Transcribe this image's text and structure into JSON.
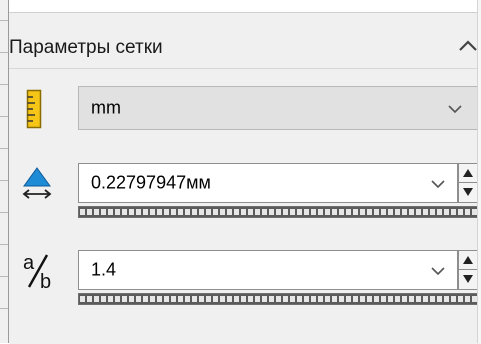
{
  "section": {
    "title": "Параметры сетки"
  },
  "units": {
    "selected": "mm"
  },
  "size": {
    "value": "0.22797947мм"
  },
  "ratio": {
    "value": "1.4"
  },
  "icons": {
    "collapse": "chevron-up-icon",
    "units": "ruler-icon",
    "size": "element-size-icon",
    "ratio": "ratio-icon"
  },
  "colors": {
    "panel_bg": "#f0f0f0",
    "ruler_fill": "#f5c518",
    "size_icon_blue": "#1e8bd6"
  }
}
